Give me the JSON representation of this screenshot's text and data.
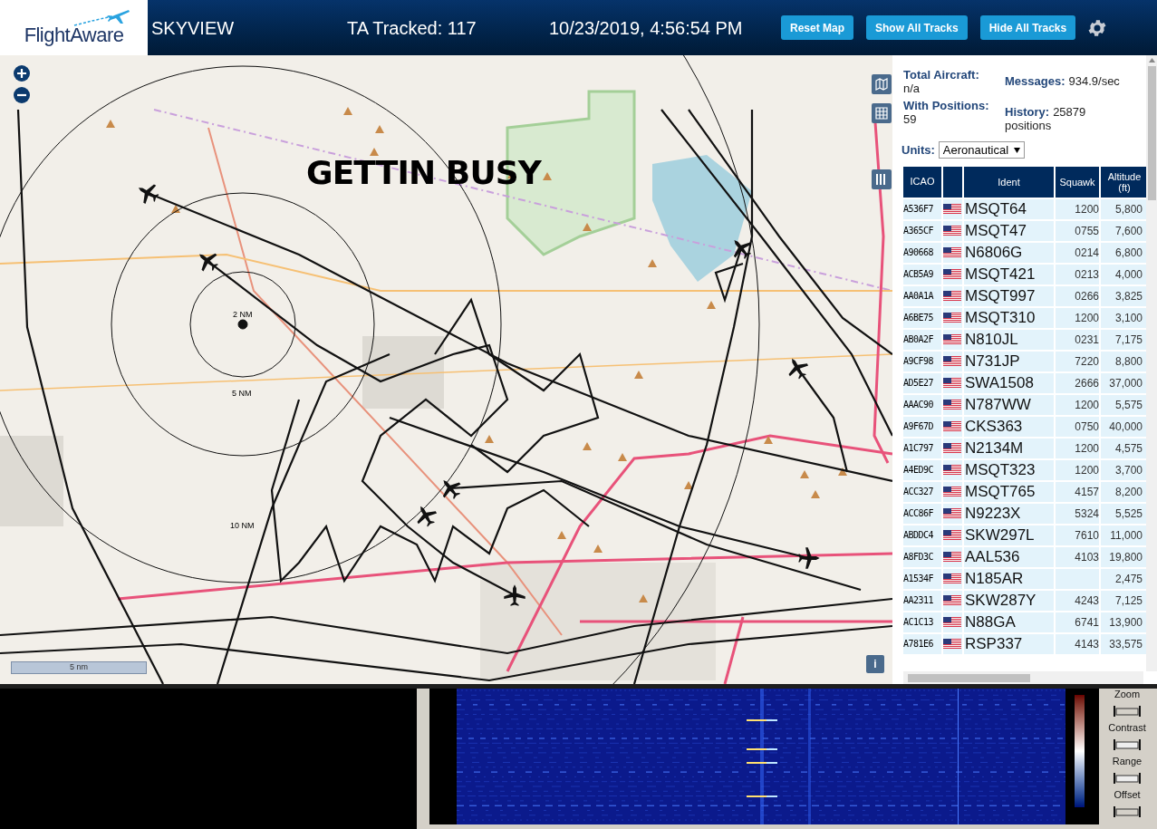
{
  "header": {
    "logo": "FlightAware",
    "title": "SKYVIEW",
    "tracked": "TA Tracked: 117",
    "datetime": "10/23/2019, 4:56:54 PM",
    "buttons": [
      "Reset Map",
      "Show All Tracks",
      "Hide All Tracks"
    ]
  },
  "map": {
    "overlay_text": "GETTIN BUSY",
    "range_rings": [
      "2 NM",
      "5 NM",
      "10 NM"
    ],
    "scale": "5 nm",
    "info": "i"
  },
  "stats": [
    {
      "label": "Total Aircraft:",
      "value": "n/a"
    },
    {
      "label": "Messages:",
      "value": "934.9/sec"
    },
    {
      "label": "With Positions:",
      "value": "59"
    },
    {
      "label": "History:",
      "value": "25879 positions"
    }
  ],
  "units": {
    "label": "Units:",
    "value": "Aeronautical"
  },
  "table": {
    "columns": [
      "ICAO",
      "Ident",
      "Squawk",
      "Altitude (ft)"
    ],
    "rows": [
      {
        "icao": "A536F7",
        "ident": "MSQT64",
        "squawk": "1200",
        "altitude": "5,800"
      },
      {
        "icao": "A365CF",
        "ident": "MSQT47",
        "squawk": "0755",
        "altitude": "7,600"
      },
      {
        "icao": "A90668",
        "ident": "N6806G",
        "squawk": "0214",
        "altitude": "6,800"
      },
      {
        "icao": "ACB5A9",
        "ident": "MSQT421",
        "squawk": "0213",
        "altitude": "4,000"
      },
      {
        "icao": "AA0A1A",
        "ident": "MSQT997",
        "squawk": "0266",
        "altitude": "3,825"
      },
      {
        "icao": "A6BE75",
        "ident": "MSQT310",
        "squawk": "1200",
        "altitude": "3,100"
      },
      {
        "icao": "AB0A2F",
        "ident": "N810JL",
        "squawk": "0231",
        "altitude": "7,175"
      },
      {
        "icao": "A9CF98",
        "ident": "N731JP",
        "squawk": "7220",
        "altitude": "8,800"
      },
      {
        "icao": "AD5E27",
        "ident": "SWA1508",
        "squawk": "2666",
        "altitude": "37,000"
      },
      {
        "icao": "AAAC90",
        "ident": "N787WW",
        "squawk": "1200",
        "altitude": "5,575"
      },
      {
        "icao": "A9F67D",
        "ident": "CKS363",
        "squawk": "0750",
        "altitude": "40,000"
      },
      {
        "icao": "A1C797",
        "ident": "N2134M",
        "squawk": "1200",
        "altitude": "4,575"
      },
      {
        "icao": "A4ED9C",
        "ident": "MSQT323",
        "squawk": "1200",
        "altitude": "3,700"
      },
      {
        "icao": "ACC327",
        "ident": "MSQT765",
        "squawk": "4157",
        "altitude": "8,200"
      },
      {
        "icao": "ACC86F",
        "ident": "N9223X",
        "squawk": "5324",
        "altitude": "5,525"
      },
      {
        "icao": "ABDDC4",
        "ident": "SKW297L",
        "squawk": "7610",
        "altitude": "11,000"
      },
      {
        "icao": "A8FD3C",
        "ident": "AAL536",
        "squawk": "4103",
        "altitude": "19,800"
      },
      {
        "icao": "A1534F",
        "ident": "N185AR",
        "altitude": "2,475"
      },
      {
        "icao": "AA2311",
        "ident": "SKW287Y",
        "squawk": "4243",
        "altitude": "7,125"
      },
      {
        "icao": "AC1C13",
        "ident": "N88GA",
        "squawk": "6741",
        "altitude": "13,900"
      },
      {
        "icao": "A781E6",
        "ident": "RSP337",
        "squawk": "4143",
        "altitude": "33,575"
      }
    ]
  },
  "waterfall": {
    "controls": [
      "Zoom",
      "Contrast",
      "Range",
      "Offset"
    ]
  }
}
